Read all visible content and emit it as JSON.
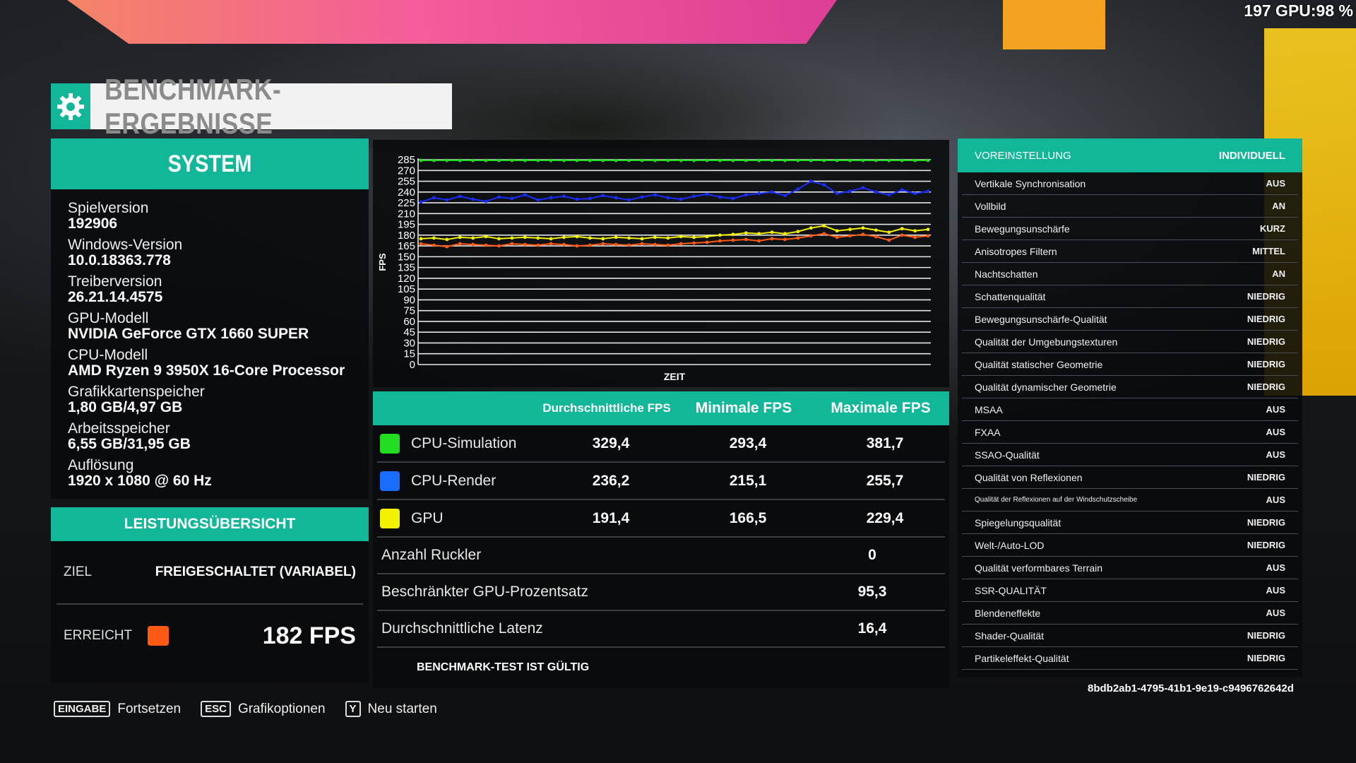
{
  "osd": "197 GPU:98 %",
  "title": "BENCHMARK-ERGEBNISSE",
  "system": {
    "heading": "SYSTEM",
    "items": [
      {
        "label": "Spielversion",
        "value": "192906"
      },
      {
        "label": "Windows-Version",
        "value": "10.0.18363.778"
      },
      {
        "label": "Treiberversion",
        "value": "26.21.14.4575"
      },
      {
        "label": "GPU-Modell",
        "value": "NVIDIA GeForce GTX 1660 SUPER"
      },
      {
        "label": "CPU-Modell",
        "value": "AMD Ryzen 9 3950X 16-Core Processor"
      },
      {
        "label": "Grafikkartenspeicher",
        "value": "1,80 GB/4,97 GB"
      },
      {
        "label": "Arbeitsspeicher",
        "value": "6,55 GB/31,95 GB"
      },
      {
        "label": "Auflösung",
        "value": "1920 x 1080 @ 60 Hz"
      }
    ]
  },
  "performance": {
    "heading": "LEISTUNGSÜBERSICHT",
    "target_label": "ZIEL",
    "target_value": "FREIGESCHALTET (VARIABEL)",
    "achieved_label": "ERREICHT",
    "achieved_value": "182 FPS",
    "achieved_color": "#ff5a14"
  },
  "chart_data": {
    "type": "line",
    "ylabel": "FPS",
    "xlabel": "ZEIT",
    "ylim": [
      0,
      285
    ],
    "yticks": [
      0,
      15,
      30,
      45,
      60,
      75,
      90,
      105,
      120,
      135,
      150,
      165,
      180,
      195,
      210,
      225,
      240,
      255,
      270,
      285
    ],
    "grid": true,
    "series": [
      {
        "name": "CPU-Simulation",
        "color": "#22dd22",
        "values": [
          284,
          284,
          284,
          284,
          284,
          284,
          284,
          284,
          284,
          284,
          284,
          284,
          284,
          284,
          284,
          284,
          284,
          284,
          284,
          284,
          284,
          284,
          284,
          284,
          284,
          284,
          284,
          284,
          284,
          284,
          284,
          284,
          284,
          284,
          284,
          284,
          284,
          284,
          284,
          284
        ]
      },
      {
        "name": "CPU-Render",
        "color": "#1a2cff",
        "values": [
          226,
          232,
          229,
          234,
          230,
          227,
          233,
          231,
          236,
          229,
          232,
          234,
          230,
          231,
          235,
          232,
          229,
          233,
          236,
          232,
          230,
          234,
          237,
          233,
          231,
          236,
          238,
          240,
          235,
          244,
          255,
          250,
          238,
          241,
          246,
          240,
          236,
          243,
          238,
          241
        ]
      },
      {
        "name": "GPU",
        "color": "#f2f200",
        "values": [
          175,
          176,
          174,
          177,
          176,
          178,
          175,
          176,
          177,
          176,
          175,
          177,
          178,
          176,
          175,
          177,
          176,
          175,
          177,
          176,
          178,
          177,
          178,
          180,
          181,
          183,
          182,
          184,
          182,
          185,
          190,
          193,
          186,
          188,
          190,
          187,
          184,
          189,
          186,
          188
        ]
      },
      {
        "name": "Latenz",
        "color": "#ff5a14",
        "values": [
          168,
          166,
          164,
          168,
          167,
          166,
          165,
          168,
          167,
          166,
          168,
          167,
          165,
          166,
          168,
          167,
          166,
          168,
          167,
          166,
          168,
          169,
          170,
          172,
          173,
          174,
          172,
          175,
          174,
          176,
          179,
          182,
          177,
          179,
          181,
          178,
          173,
          180,
          177,
          179
        ]
      }
    ]
  },
  "results": {
    "headers": [
      "",
      "Durchschnittliche FPS",
      "Minimale FPS",
      "Maximale FPS"
    ],
    "rows": [
      {
        "name": "CPU-Simulation",
        "color": "#22dd22",
        "avg": "329,4",
        "min": "293,4",
        "max": "381,7"
      },
      {
        "name": "CPU-Render",
        "color": "#1a6cff",
        "avg": "236,2",
        "min": "215,1",
        "max": "255,7"
      },
      {
        "name": "GPU",
        "color": "#f2f200",
        "avg": "191,4",
        "min": "166,5",
        "max": "229,4"
      }
    ],
    "stats": [
      {
        "label": "Anzahl Ruckler",
        "value": "0"
      },
      {
        "label": "Beschränkter GPU-Prozentsatz",
        "value": "95,3"
      },
      {
        "label": "Durchschnittliche Latenz",
        "value": "16,4"
      }
    ],
    "valid_text": "BENCHMARK-TEST IST GÜLTIG"
  },
  "settings": {
    "preset_label": "VOREINSTELLUNG",
    "preset_value": "INDIVIDUELL",
    "rows": [
      {
        "label": "Vertikale Synchronisation",
        "value": "AUS"
      },
      {
        "label": "Vollbild",
        "value": "AN"
      },
      {
        "label": "Bewegungsunschärfe",
        "value": "KURZ"
      },
      {
        "label": "Anisotropes Filtern",
        "value": "MITTEL"
      },
      {
        "label": "Nachtschatten",
        "value": "AN"
      },
      {
        "label": "Schattenqualität",
        "value": "NIEDRIG"
      },
      {
        "label": "Bewegungsunschärfe-Qualität",
        "value": "NIEDRIG"
      },
      {
        "label": "Qualität der Umgebungstexturen",
        "value": "NIEDRIG"
      },
      {
        "label": "Qualität statischer Geometrie",
        "value": "NIEDRIG"
      },
      {
        "label": "Qualität dynamischer Geometrie",
        "value": "NIEDRIG"
      },
      {
        "label": "MSAA",
        "value": "AUS"
      },
      {
        "label": "FXAA",
        "value": "AUS"
      },
      {
        "label": "SSAO-Qualität",
        "value": "AUS"
      },
      {
        "label": "Qualität von Reflexionen",
        "value": "NIEDRIG"
      },
      {
        "label": "Qualität der Reflexionen auf der Windschutzscheibe",
        "value": "AUS",
        "small": true
      },
      {
        "label": "Spiegelungsqualität",
        "value": "NIEDRIG"
      },
      {
        "label": "Welt-/Auto-LOD",
        "value": "NIEDRIG"
      },
      {
        "label": "Qualität verformbares Terrain",
        "value": "AUS"
      },
      {
        "label": "SSR-QUALITÄT",
        "value": "AUS"
      },
      {
        "label": "Blendeneffekte",
        "value": "AUS"
      },
      {
        "label": "Shader-Qualität",
        "value": "NIEDRIG"
      },
      {
        "label": "Partikeleffekt-Qualität",
        "value": "NIEDRIG"
      }
    ]
  },
  "uuid": "8bdb2ab1-4795-41b1-9e19-c9496762642d",
  "hints": [
    {
      "key": "EINGABE",
      "label": "Fortsetzen",
      "icon": "enter-key-icon"
    },
    {
      "key": "ESC",
      "label": "Grafikoptionen",
      "icon": "esc-key-icon"
    },
    {
      "key": "Y",
      "label": "Neu starten",
      "icon": "y-key-icon"
    }
  ],
  "colors": {
    "accent": "#12b79a"
  }
}
